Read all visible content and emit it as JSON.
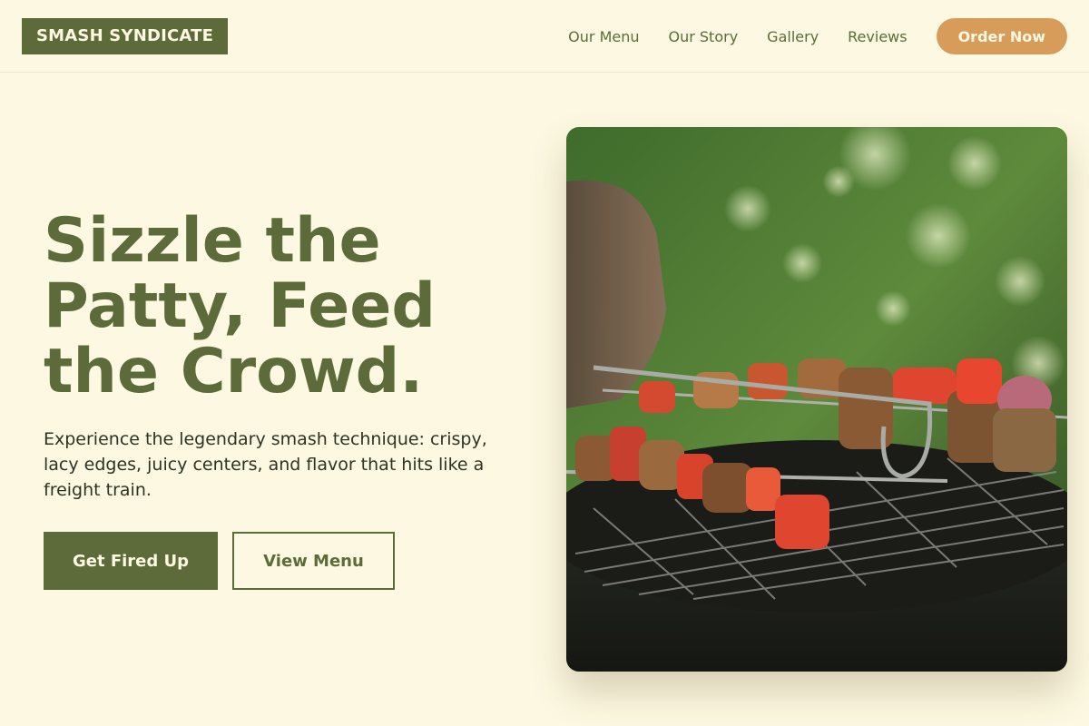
{
  "brand": {
    "name": "SMASH SYNDICATE"
  },
  "nav": {
    "items": [
      {
        "label": "Our Menu"
      },
      {
        "label": "Our Story"
      },
      {
        "label": "Gallery"
      },
      {
        "label": "Reviews"
      }
    ],
    "cta_label": "Order Now"
  },
  "hero": {
    "title_lines": [
      "Sizzle the",
      "Patty, Feed",
      "the Crowd."
    ],
    "subtitle": "Experience the legendary smash technique: crispy, lacy edges, juicy centers, and flavor that hits like a freight train.",
    "primary_label": "Get Fired Up",
    "secondary_label": "View Menu",
    "image_subject": "grilled-kebab-skewers-photo"
  },
  "colors": {
    "background": "#fdf8e1",
    "brand_green": "#5d6b3a",
    "accent_orange": "#d89c5a",
    "text_dark": "#2f3324"
  }
}
